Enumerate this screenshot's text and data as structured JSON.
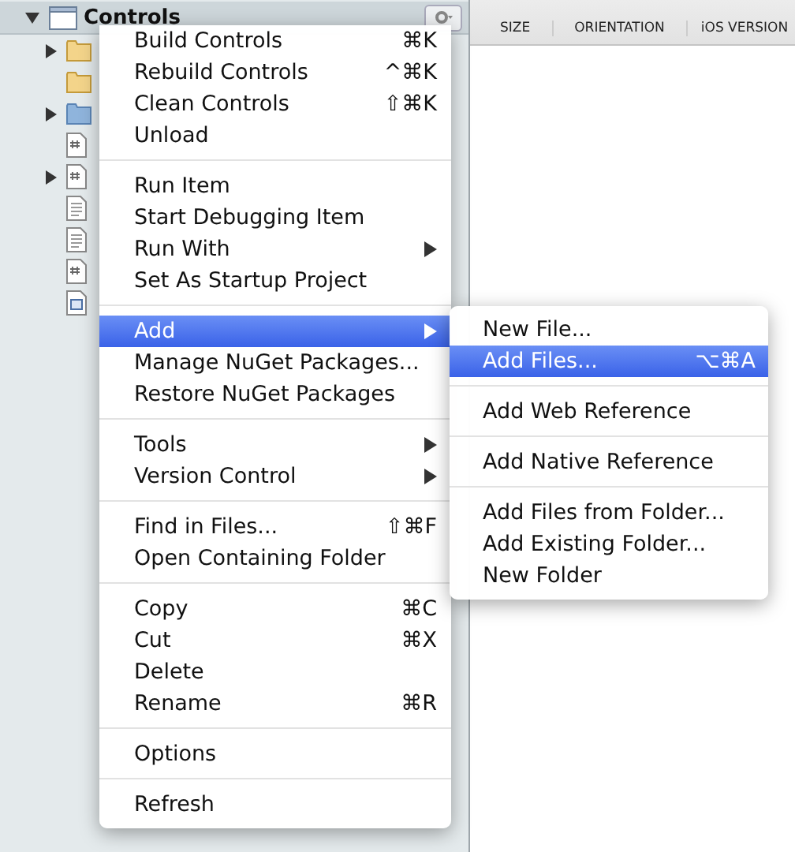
{
  "sidebar": {
    "root": {
      "label": "Controls",
      "expanded": true
    },
    "items": [
      {
        "kind": "folder",
        "expandable": true,
        "expanded": false
      },
      {
        "kind": "folder",
        "expandable": false
      },
      {
        "kind": "bluefolder",
        "expandable": true,
        "expanded": false
      },
      {
        "kind": "code",
        "expandable": false
      },
      {
        "kind": "code",
        "expandable": true,
        "expanded": false
      },
      {
        "kind": "document",
        "expandable": false
      },
      {
        "kind": "document",
        "expandable": false
      },
      {
        "kind": "code",
        "expandable": false
      },
      {
        "kind": "storyboard",
        "expandable": false
      }
    ]
  },
  "columns": [
    "SIZE",
    "ORIENTATION",
    "iOS VERSION"
  ],
  "context_menu": {
    "groups": [
      [
        {
          "label": "Build Controls",
          "shortcut": "⌘K",
          "submenu": false,
          "selected": false
        },
        {
          "label": "Rebuild Controls",
          "shortcut": "^⌘K",
          "submenu": false,
          "selected": false
        },
        {
          "label": "Clean Controls",
          "shortcut": "⇧⌘K",
          "submenu": false,
          "selected": false
        },
        {
          "label": "Unload",
          "submenu": false,
          "selected": false
        }
      ],
      [
        {
          "label": "Run Item",
          "submenu": false,
          "selected": false
        },
        {
          "label": "Start Debugging Item",
          "submenu": false,
          "selected": false
        },
        {
          "label": "Run With",
          "submenu": true,
          "selected": false
        },
        {
          "label": "Set As Startup Project",
          "submenu": false,
          "selected": false
        }
      ],
      [
        {
          "label": "Add",
          "submenu": true,
          "selected": true
        },
        {
          "label": "Manage NuGet Packages...",
          "submenu": false,
          "selected": false
        },
        {
          "label": "Restore NuGet Packages",
          "submenu": false,
          "selected": false
        }
      ],
      [
        {
          "label": "Tools",
          "submenu": true,
          "selected": false
        },
        {
          "label": "Version Control",
          "submenu": true,
          "selected": false
        }
      ],
      [
        {
          "label": "Find in Files...",
          "shortcut": "⇧⌘F",
          "submenu": false,
          "selected": false
        },
        {
          "label": "Open Containing Folder",
          "submenu": false,
          "selected": false
        }
      ],
      [
        {
          "label": "Copy",
          "shortcut": "⌘C",
          "submenu": false,
          "selected": false
        },
        {
          "label": "Cut",
          "shortcut": "⌘X",
          "submenu": false,
          "selected": false
        },
        {
          "label": "Delete",
          "submenu": false,
          "selected": false
        },
        {
          "label": "Rename",
          "shortcut": "⌘R",
          "submenu": false,
          "selected": false
        }
      ],
      [
        {
          "label": "Options",
          "submenu": false,
          "selected": false
        }
      ],
      [
        {
          "label": "Refresh",
          "submenu": false,
          "selected": false
        }
      ]
    ]
  },
  "submenu": {
    "groups": [
      [
        {
          "label": "New File...",
          "selected": false
        },
        {
          "label": "Add Files...",
          "shortcut": "⌥⌘A",
          "selected": true
        }
      ],
      [
        {
          "label": "Add Web Reference",
          "selected": false
        }
      ],
      [
        {
          "label": "Add Native Reference",
          "selected": false
        }
      ],
      [
        {
          "label": "Add Files from Folder...",
          "selected": false
        },
        {
          "label": "Add Existing Folder...",
          "selected": false
        },
        {
          "label": "New Folder",
          "selected": false
        }
      ]
    ]
  }
}
